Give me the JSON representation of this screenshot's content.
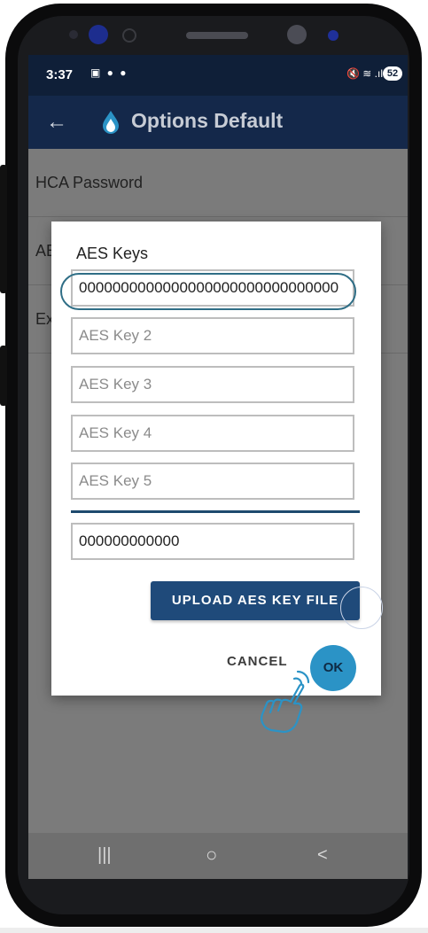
{
  "status_bar": {
    "time": "3:37",
    "left_icons": "▣ ● ●",
    "right_icons": "🔇 ≋ .ıl",
    "battery_level": "52"
  },
  "app_bar": {
    "back_icon": "arrow-left-icon",
    "logo_icon": "water-drop-icon",
    "title": "Options Default"
  },
  "list": {
    "items": [
      {
        "label": "HCA Password"
      },
      {
        "label": "AE"
      },
      {
        "label": "Ex"
      }
    ]
  },
  "dialog": {
    "title": "AES Keys",
    "key1_value": "0000000000000000000000000000000",
    "key2_placeholder": "AES Key 2",
    "key3_placeholder": "AES Key 3",
    "key4_placeholder": "AES Key 4",
    "key5_placeholder": "AES Key 5",
    "extra_value": "000000000000",
    "upload_label": "UPLOAD AES KEY FILE",
    "cancel_label": "CANCEL",
    "ok_label": "OK"
  },
  "nav_bar": {
    "recents_icon": "|||",
    "home_icon": "○",
    "back_icon": "<"
  },
  "colors": {
    "app_bar": "#14284a",
    "accent": "#2b93c6",
    "button": "#1f4a7a",
    "focus": "#2f6e86"
  }
}
